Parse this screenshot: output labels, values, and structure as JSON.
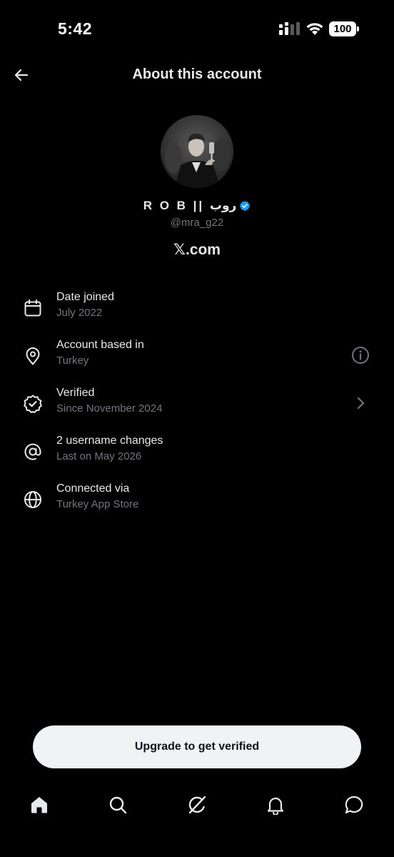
{
  "status_bar": {
    "time": "5:42",
    "battery": "100"
  },
  "header": {
    "title": "About this account",
    "back_icon": "arrow-left-icon"
  },
  "profile": {
    "display_name": "R O B || روب",
    "handle": "@mra_g22",
    "verified_color": "#1d9bf0",
    "site": "𝕏.com"
  },
  "rows": [
    {
      "icon": "calendar-icon",
      "title": "Date joined",
      "subtitle": "July 2022"
    },
    {
      "icon": "location-pin-icon",
      "title": "Account based in",
      "subtitle": "Turkey",
      "action_icon": "info-icon"
    },
    {
      "icon": "verified-check-icon",
      "title": "Verified",
      "subtitle": "Since November 2024",
      "action_icon": "chevron-right-icon"
    },
    {
      "icon": "at-sign-icon",
      "title": "2 username changes",
      "subtitle": "Last on May 2026"
    },
    {
      "icon": "globe-icon",
      "title": "Connected via",
      "subtitle": "Turkey App Store"
    }
  ],
  "upgrade": {
    "label": "Upgrade to get verified"
  },
  "nav": {
    "items": [
      "home-icon",
      "search-icon",
      "grok-icon",
      "notifications-bell-icon",
      "messages-icon"
    ]
  },
  "colors": {
    "background": "#000000",
    "text": "#e7e9ea",
    "secondary": "#71767b",
    "accent": "#1d9bf0",
    "button_bg": "#eff3f4"
  }
}
